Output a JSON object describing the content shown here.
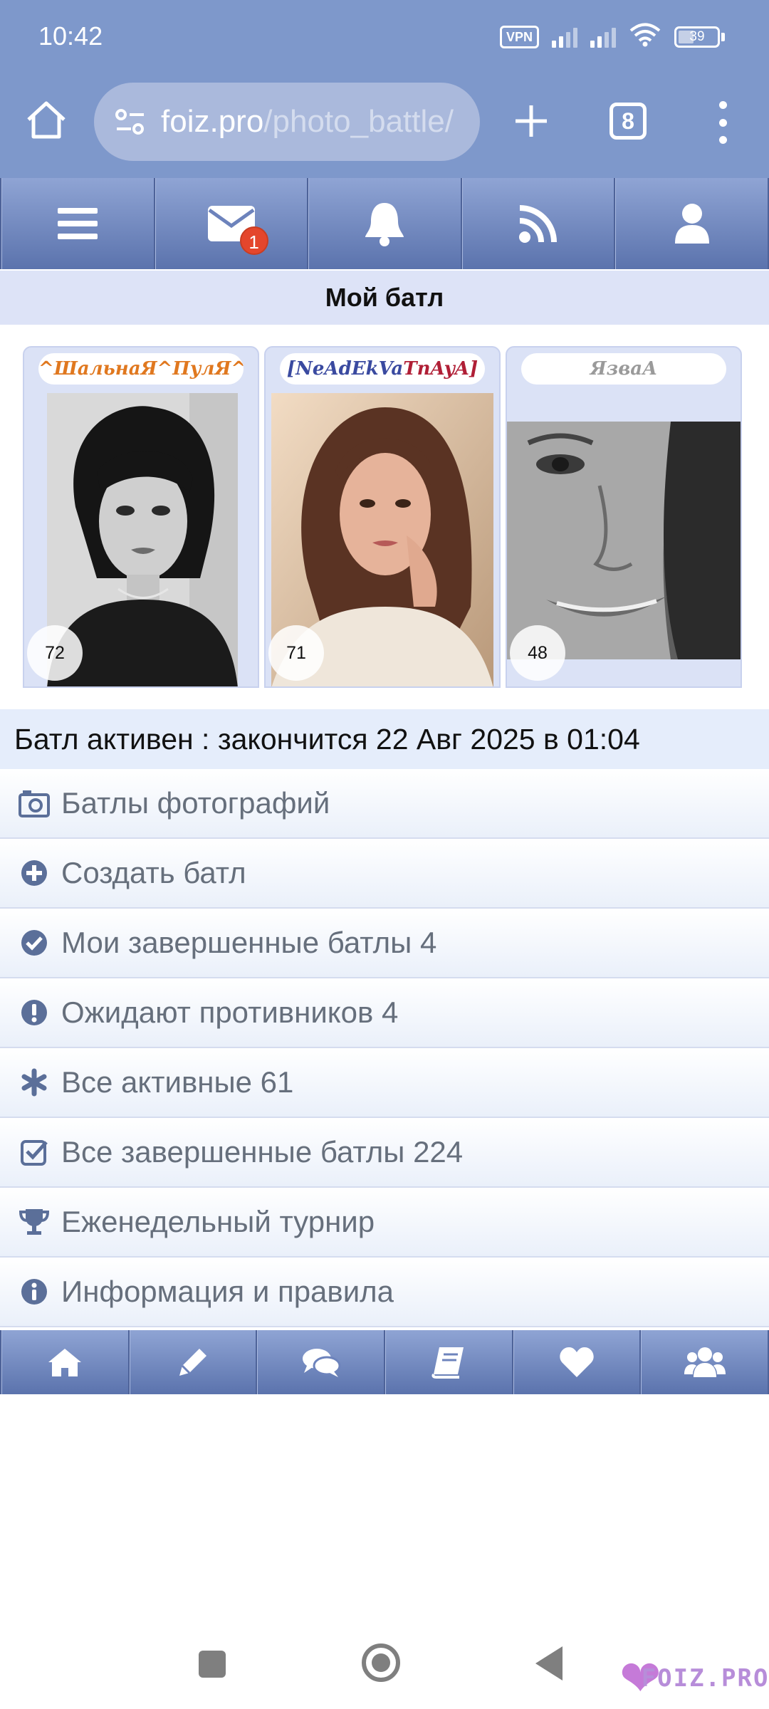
{
  "status_bar": {
    "time": "10:42",
    "vpn_label": "VPN",
    "battery": "39"
  },
  "browser": {
    "url_domain": "foiz.pro",
    "url_path": "/photo_battle/",
    "tab_count": "8"
  },
  "top_nav": {
    "mail_badge": "1",
    "icons": [
      "menu-icon",
      "mail-icon",
      "bell-icon",
      "rss-icon",
      "user-icon"
    ]
  },
  "battle": {
    "title": "Мой батл",
    "participants": [
      {
        "name": "^ШальнаЯ^ПулЯ^",
        "score": "72"
      },
      {
        "name": "[NeAdEkVaTnAyA]",
        "score": "71"
      },
      {
        "name": "ЯзваА",
        "score": "48"
      }
    ],
    "status": "Батл активен : закончится 22 Авг 2025 в 01:04"
  },
  "menu": {
    "items": [
      {
        "label": "Батлы фотографий",
        "icon": "camera-icon"
      },
      {
        "label": "Создать батл",
        "icon": "plus-circle-icon"
      },
      {
        "label": "Мои завершенные батлы 4",
        "icon": "check-circle-icon"
      },
      {
        "label": "Ожидают противников 4",
        "icon": "exclamation-circle-icon"
      },
      {
        "label": "Все активные 61",
        "icon": "asterisk-icon"
      },
      {
        "label": "Все завершенные батлы 224",
        "icon": "check-square-icon"
      },
      {
        "label": "Еженедельный турнир",
        "icon": "trophy-icon"
      },
      {
        "label": "Информация и правила",
        "icon": "info-circle-icon"
      }
    ]
  },
  "bottom_nav": {
    "icons": [
      "home-icon",
      "pencil-icon",
      "chat-icon",
      "book-icon",
      "heart-icon",
      "users-icon"
    ]
  },
  "watermark": {
    "text": "FOIZ.PRO"
  },
  "colors": {
    "chrome": "#7e98cb",
    "nav_gradient_top": "#8fa4d4",
    "nav_gradient_bottom": "#5b73ad",
    "title_bg": "#dde3f7",
    "name1": "#e0781f",
    "name2_a": "#3a4aa0",
    "name2_b": "#b01f36",
    "name3": "#9a9a9a"
  }
}
